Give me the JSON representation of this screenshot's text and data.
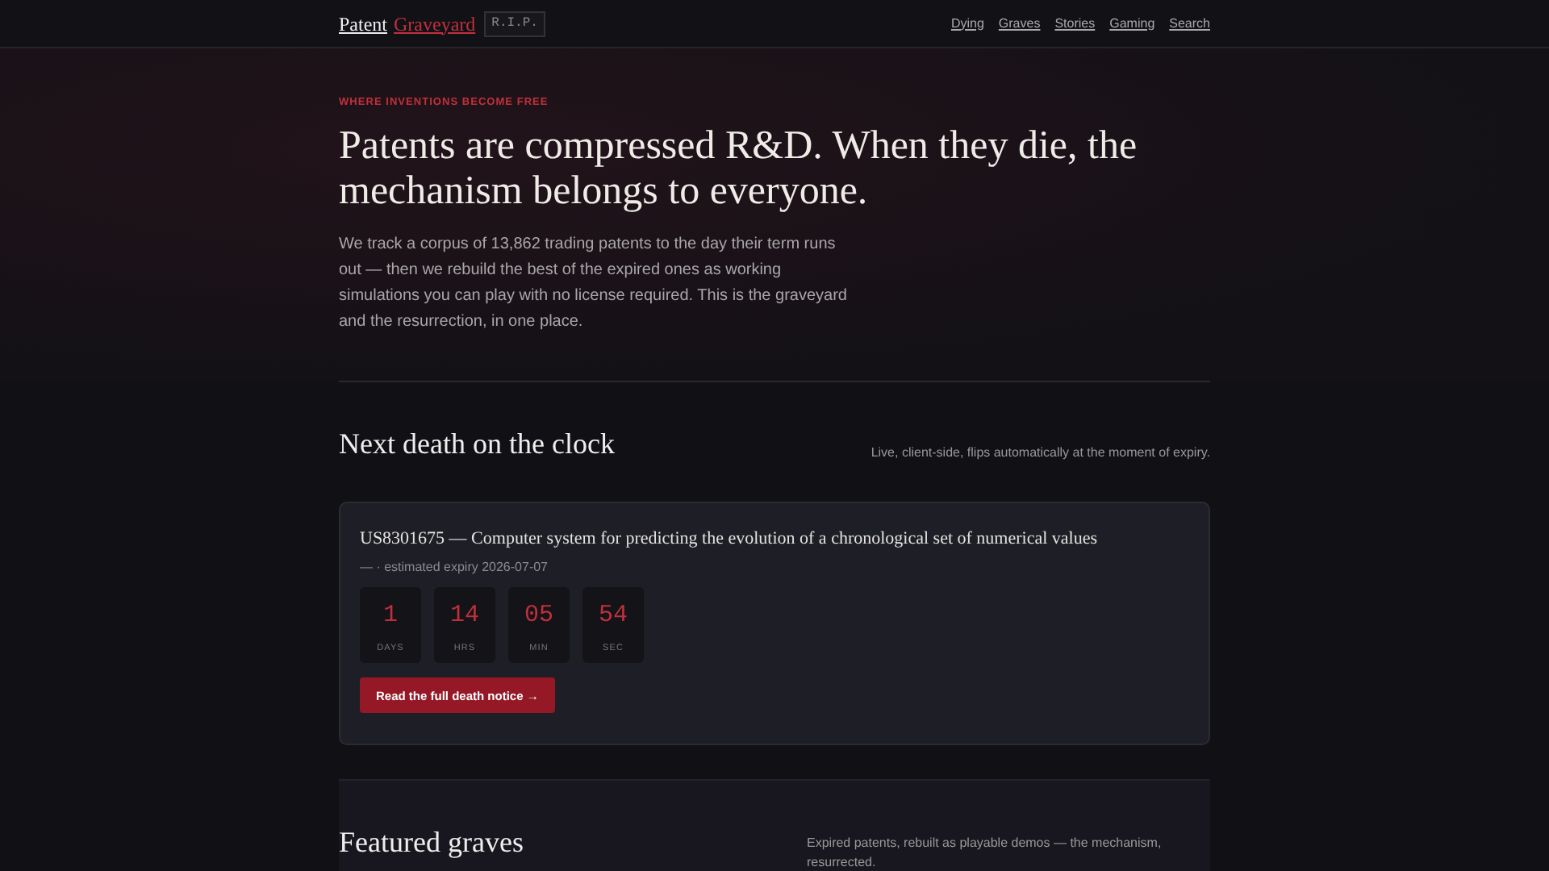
{
  "brand": {
    "first": "Patent",
    "second": "Graveyard",
    "badge": "R.I.P."
  },
  "nav": [
    "Dying",
    "Graves",
    "Stories",
    "Gaming",
    "Search"
  ],
  "hero": {
    "eyebrow": "WHERE INVENTIONS BECOME FREE",
    "title": "Patents are compressed R&D. When they die, the mechanism belongs to everyone.",
    "body": "We track a corpus of 13,862 trading patents to the day their term runs out — then we rebuild the best of the expired ones as working simulations you can play with no license required. This is the graveyard and the resurrection, in one place."
  },
  "next": {
    "title": "Next death on the clock",
    "note": "Live, client-side, flips automatically at the moment of expiry.",
    "patent": "US8301675 — Computer system for predicting the evolution of a chronological set of numerical values",
    "expiry": "— · estimated expiry 2026-07-07",
    "countdown": [
      {
        "value": "1",
        "unit": "DAYS"
      },
      {
        "value": "14",
        "unit": "HRS"
      },
      {
        "value": "05",
        "unit": "MIN"
      },
      {
        "value": "54",
        "unit": "SEC"
      }
    ],
    "button": "Read the full death notice →"
  },
  "featured": {
    "title": "Featured graves",
    "note": "Expired patents, rebuilt as playable demos — the mechanism, resurrected."
  }
}
